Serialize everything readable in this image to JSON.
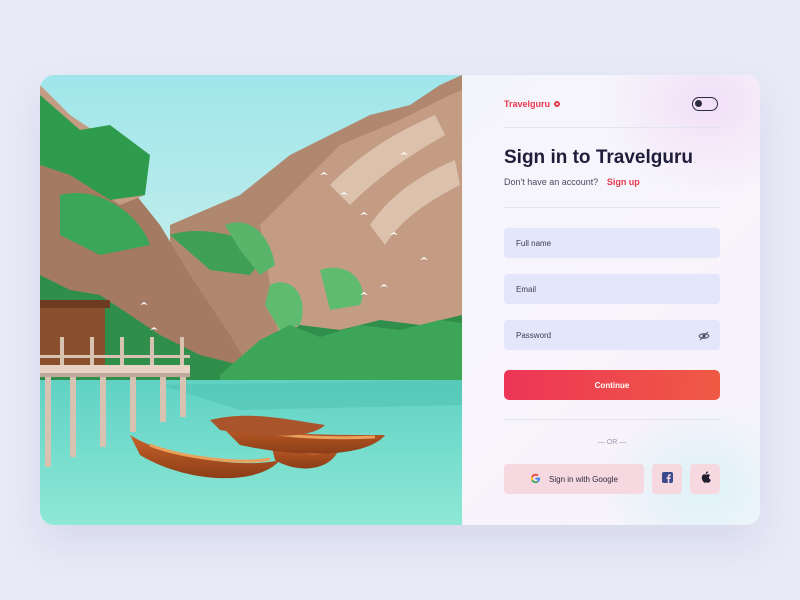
{
  "brand": {
    "name": "Travelguru"
  },
  "header": {
    "title": "Sign in to Travelguru"
  },
  "signup_prompt": {
    "text": "Don't have an account?",
    "link": "Sign up"
  },
  "form": {
    "full_name_placeholder": "Full name",
    "email_placeholder": "Email",
    "password_placeholder": "Password",
    "submit_label": "Continue"
  },
  "divider_text": "OR",
  "social": {
    "google_label": "Sign in with Google",
    "facebook_icon": "facebook-icon",
    "apple_icon": "apple-icon"
  },
  "colors": {
    "accent": "#e8384f",
    "field_bg": "#e4e6fa",
    "page_bg": "#e8eaf7",
    "title": "#1f1d3a"
  },
  "toggle": {
    "state": "off"
  }
}
